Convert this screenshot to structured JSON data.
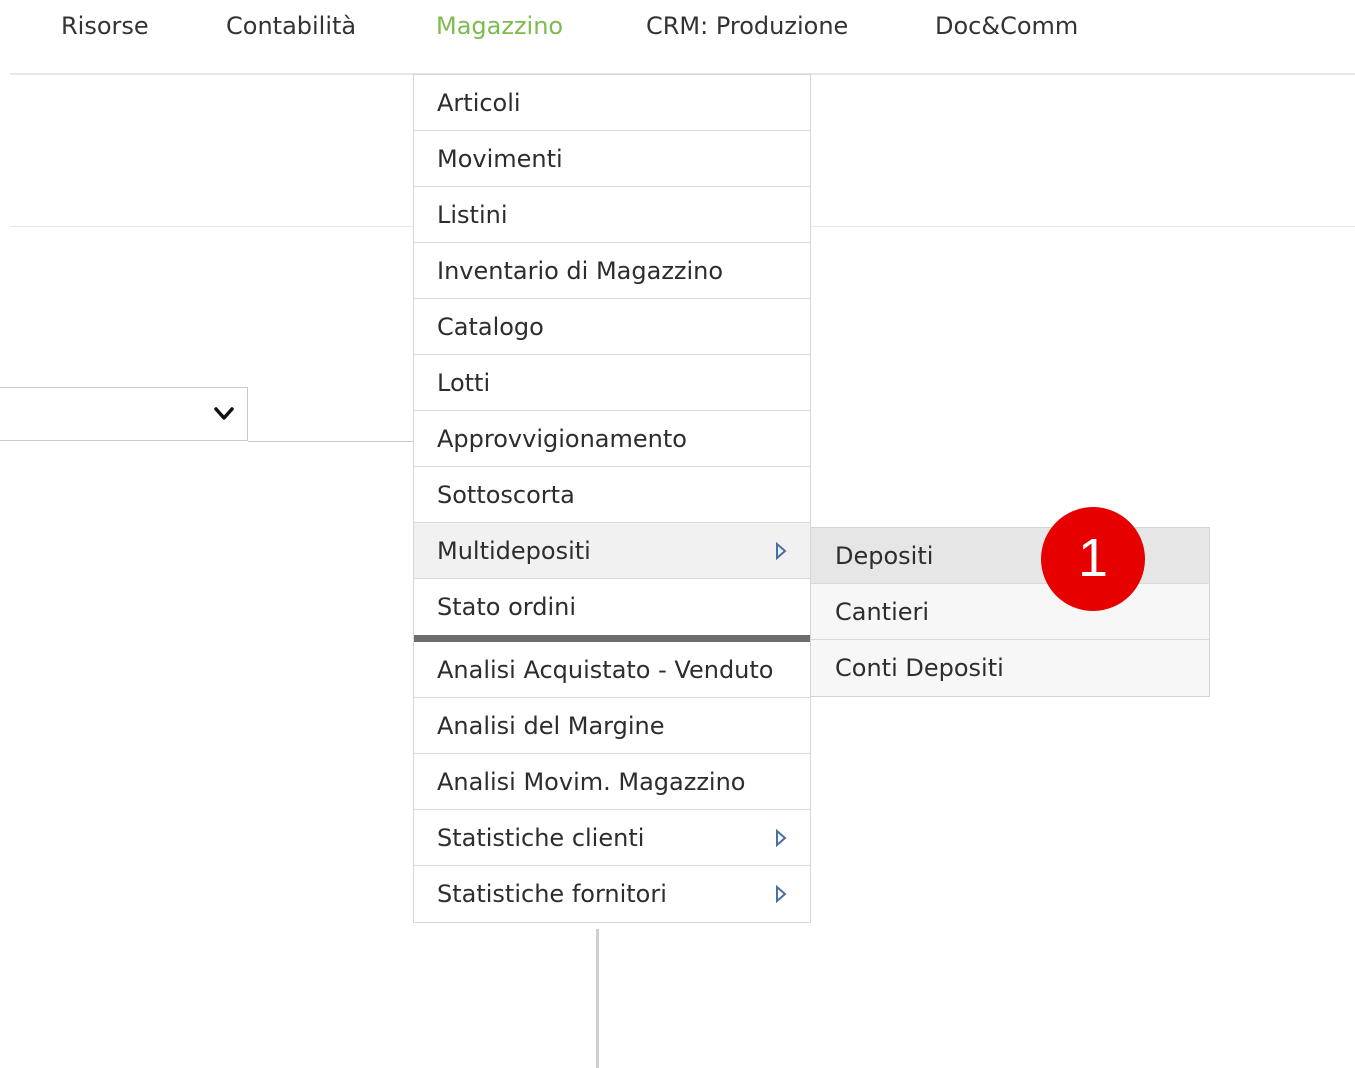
{
  "nav": {
    "items": [
      {
        "label": "Risorse"
      },
      {
        "label": "Contabilità"
      },
      {
        "label": "Magazzino"
      },
      {
        "label": "CRM: Produzione"
      },
      {
        "label": "Doc&Comm"
      }
    ],
    "active": "Magazzino",
    "active_color": "#7dbb4f"
  },
  "menu": {
    "items": [
      {
        "label": "Articoli"
      },
      {
        "label": "Movimenti"
      },
      {
        "label": "Listini"
      },
      {
        "label": "Inventario di Magazzino"
      },
      {
        "label": "Catalogo"
      },
      {
        "label": "Lotti"
      },
      {
        "label": "Approvvigionamento"
      },
      {
        "label": "Sottoscorta"
      },
      {
        "label": "Multidepositi",
        "has_submenu": true,
        "icon": "triangle-right-icon"
      },
      {
        "label": "Stato ordini"
      }
    ],
    "analysis_items": [
      {
        "label": "Analisi Acquistato - Venduto"
      },
      {
        "label": "Analisi del Margine"
      },
      {
        "label": "Analisi Movim. Magazzino"
      },
      {
        "label": "Statistiche clienti",
        "has_submenu": true,
        "icon": "triangle-right-icon"
      },
      {
        "label": "Statistiche fornitori",
        "has_submenu": true,
        "icon": "triangle-right-icon"
      }
    ]
  },
  "submenu": {
    "items": [
      {
        "label": "Depositi"
      },
      {
        "label": "Cantieri"
      },
      {
        "label": "Conti Depositi"
      }
    ]
  },
  "badge": {
    "label": "1",
    "color": "#e60000"
  }
}
